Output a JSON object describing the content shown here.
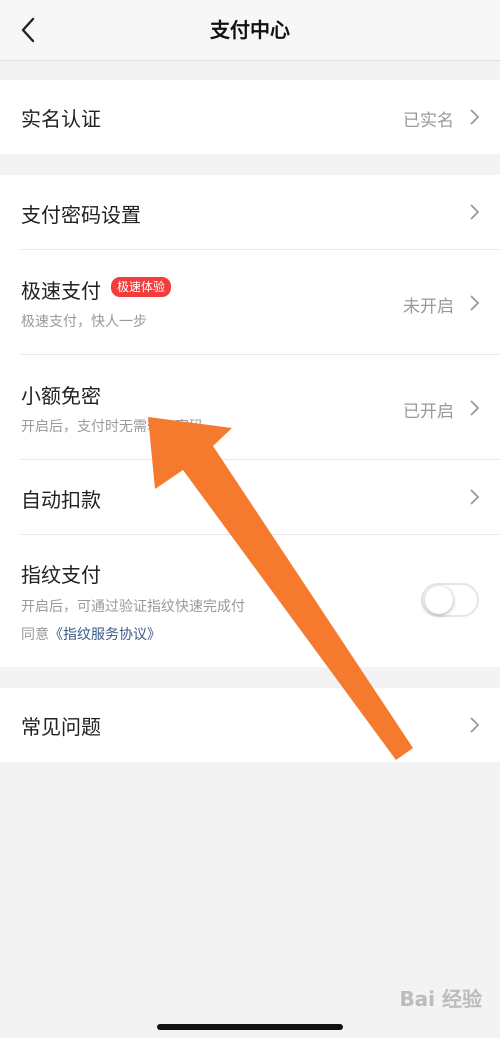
{
  "nav": {
    "title": "支付中心",
    "back_icon": "chevron-left-icon"
  },
  "real_name": {
    "label": "实名认证",
    "status": "已实名"
  },
  "pay_password": {
    "label": "支付密码设置"
  },
  "fast_pay": {
    "label": "极速支付",
    "badge": "极速体验",
    "subtitle": "极速支付，快人一步",
    "status": "未开启"
  },
  "small_free": {
    "label": "小额免密",
    "subtitle": "开启后，支付时无需输入密码",
    "status": "已开启"
  },
  "auto_debit": {
    "label": "自动扣款"
  },
  "fingerprint": {
    "label": "指纹支付",
    "subtitle": "开启后，可通过验证指纹快速完成付",
    "agree_prefix": "同意",
    "agreement_link": "《指纹服务协议》",
    "toggle_on": false
  },
  "faq": {
    "label": "常见问题"
  },
  "watermark": "Bai 经验",
  "colors": {
    "badge": "#f23d3d",
    "arrow": "#f57a2e",
    "link": "#3a5a86"
  }
}
